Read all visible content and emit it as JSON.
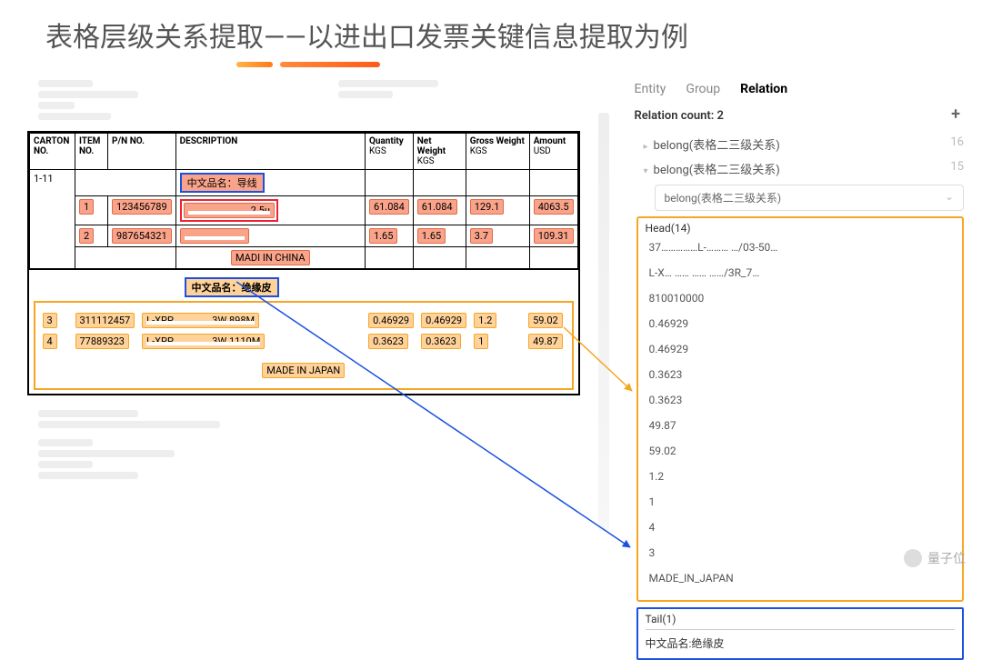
{
  "page_title": "表格层级关系提取——以进出口发票关键信息提取为例",
  "table": {
    "headers": {
      "carton_no": "CARTON NO.",
      "item_no": "ITEM NO.",
      "pn_no": "P/N NO.",
      "description": "DESCRIPTION",
      "quantity": "Quantity",
      "quantity_unit": "KGS",
      "net_weight": "Net Weight",
      "net_weight_unit": "KGS",
      "gross_weight": "Gross Weight",
      "gross_weight_unit": "KGS",
      "amount": "Amount",
      "amount_unit": "USD"
    },
    "section1": {
      "desc_label": "中文品名：导线",
      "carton": "1-11",
      "rows": [
        {
          "item": "1",
          "pn": "123456789",
          "desc": "……………………… 2.5u",
          "qty": "61.084",
          "net": "61.084",
          "gross": "129.1",
          "amt": "4063.5"
        },
        {
          "item": "2",
          "pn": "987654321",
          "desc": "………………………",
          "qty": "1.65",
          "net": "1.65",
          "gross": "3.7",
          "amt": "109.31"
        }
      ],
      "origin": "MADI IN CHINA"
    },
    "section2": {
      "desc_label": "中文品名：绝缘皮",
      "rows": [
        {
          "item": "3",
          "pn": "311112457",
          "desc": "L-XPP………………3W  898M",
          "qty": "0.46929",
          "net": "0.46929",
          "gross": "1.2",
          "amt": "59.02"
        },
        {
          "item": "4",
          "pn": "77889323",
          "desc": "L-XPP………………3W 1110M",
          "qty": "0.3623",
          "net": "0.3623",
          "gross": "1",
          "amt": "49.87"
        }
      ],
      "origin": "MADE IN JAPAN"
    }
  },
  "panel": {
    "tabs": {
      "entity": "Entity",
      "group": "Group",
      "relation": "Relation"
    },
    "relation_count_label": "Relation count: 2",
    "relations": [
      {
        "label": "belong(表格二三级关系)",
        "count": "16"
      },
      {
        "label": "belong(表格二三级关系)",
        "count": "15"
      }
    ],
    "select_label": "belong(表格二三级关系)",
    "head": {
      "title": "Head(14)",
      "items": [
        "37……………L-……… …/03-50…",
        "L-X… …… …… ……/3R_7…",
        "810010000",
        "0.46929",
        "0.46929",
        "0.3623",
        "0.3623",
        "49.87",
        "59.02",
        "1.2",
        "1",
        "4",
        "3",
        "MADE_IN_JAPAN"
      ]
    },
    "tail": {
      "title": "Tail(1)",
      "item": "中文品名:绝缘皮"
    }
  },
  "watermark": "量子位"
}
